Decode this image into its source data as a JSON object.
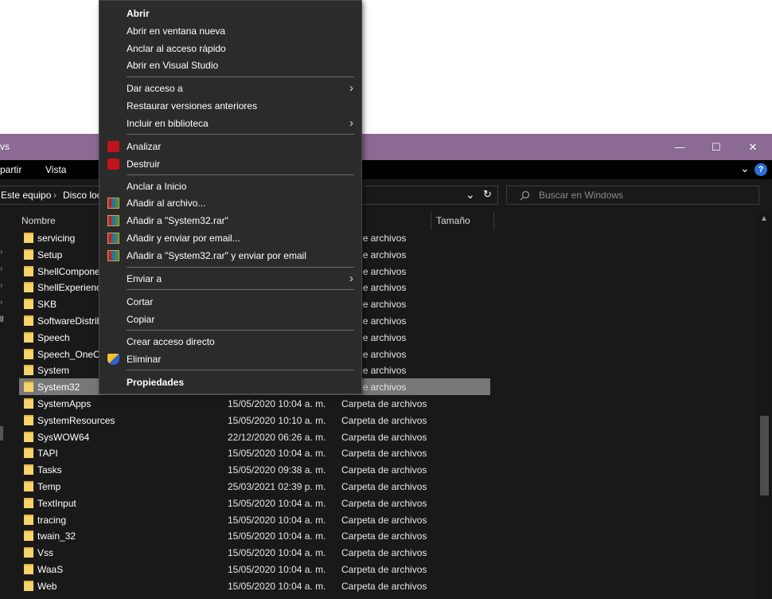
{
  "window": {
    "title_partial": "vs",
    "minimize": "—",
    "maximize": "☐",
    "close": "✕",
    "title_bg": "#8b6a94"
  },
  "ribbon": {
    "tab_share": "partir",
    "tab_view": "Vista",
    "expand": "⌄",
    "help": "?"
  },
  "address": {
    "crumb1": "Este equipo",
    "sep": "›",
    "crumb2": "Disco loc",
    "dropdown": "⌄",
    "refresh": "↻"
  },
  "search": {
    "placeholder": "Buscar en Windows",
    "icon": "search-icon"
  },
  "columns": {
    "name": "Nombre",
    "size": "Tamaño"
  },
  "rows": [
    {
      "name": "servicing",
      "date": "",
      "type": "eta de archivos",
      "selected": false
    },
    {
      "name": "Setup",
      "date": "",
      "type": "eta de archivos",
      "selected": false
    },
    {
      "name": "ShellCompone",
      "date": "",
      "type": "eta de archivos",
      "selected": false
    },
    {
      "name": "ShellExperienc",
      "date": "",
      "type": "eta de archivos",
      "selected": false
    },
    {
      "name": "SKB",
      "date": "",
      "type": "eta de archivos",
      "selected": false
    },
    {
      "name": "SoftwareDistrib",
      "date": "",
      "type": "eta de archivos",
      "selected": false
    },
    {
      "name": "Speech",
      "date": "",
      "type": "eta de archivos",
      "selected": false
    },
    {
      "name": "Speech_OneCo",
      "date": "",
      "type": "eta de archivos",
      "selected": false
    },
    {
      "name": "System",
      "date": "",
      "type": "eta de archivos",
      "selected": false
    },
    {
      "name": "System32",
      "date": "",
      "type": "eta de archivos",
      "selected": true
    },
    {
      "name": "SystemApps",
      "date": "15/05/2020 10:04 a. m.",
      "type": "Carpeta de archivos",
      "selected": false
    },
    {
      "name": "SystemResources",
      "date": "15/05/2020 10:10 a. m.",
      "type": "Carpeta de archivos",
      "selected": false
    },
    {
      "name": "SysWOW64",
      "date": "22/12/2020 06:26 a. m.",
      "type": "Carpeta de archivos",
      "selected": false
    },
    {
      "name": "TAPI",
      "date": "15/05/2020 10:04 a. m.",
      "type": "Carpeta de archivos",
      "selected": false
    },
    {
      "name": "Tasks",
      "date": "15/05/2020 09:38 a. m.",
      "type": "Carpeta de archivos",
      "selected": false
    },
    {
      "name": "Temp",
      "date": "25/03/2021 02:39 p. m.",
      "type": "Carpeta de archivos",
      "selected": false
    },
    {
      "name": "TextInput",
      "date": "15/05/2020 10:04 a. m.",
      "type": "Carpeta de archivos",
      "selected": false
    },
    {
      "name": "tracing",
      "date": "15/05/2020 10:04 a. m.",
      "type": "Carpeta de archivos",
      "selected": false
    },
    {
      "name": "twain_32",
      "date": "15/05/2020 10:04 a. m.",
      "type": "Carpeta de archivos",
      "selected": false
    },
    {
      "name": "Vss",
      "date": "15/05/2020 10:04 a. m.",
      "type": "Carpeta de archivos",
      "selected": false
    },
    {
      "name": "WaaS",
      "date": "15/05/2020 10:04 a. m.",
      "type": "Carpeta de archivos",
      "selected": false
    },
    {
      "name": "Web",
      "date": "15/05/2020 10:04 a. m.",
      "type": "Carpeta de archivos",
      "selected": false
    }
  ],
  "context_menu": {
    "open": "Abrir",
    "open_new_window": "Abrir en ventana nueva",
    "pin_quick_access": "Anclar al acceso rápido",
    "open_visual_studio": "Abrir en Visual Studio",
    "give_access": "Dar acceso a",
    "restore_versions": "Restaurar versiones anteriores",
    "include_library": "Incluir en biblioteca",
    "scan": "Analizar",
    "shred": "Destruir",
    "pin_start": "Anclar a Inicio",
    "add_archive": "Añadir al archivo...",
    "add_rar": "Añadir a \"System32.rar\"",
    "add_email": "Añadir y enviar por email...",
    "add_rar_email": "Añadir a \"System32.rar\" y enviar por email",
    "send_to": "Enviar a",
    "cut": "Cortar",
    "copy": "Copiar",
    "create_shortcut": "Crear acceso directo",
    "delete": "Eliminar",
    "properties": "Propiedades",
    "submenu_arrow": "›"
  }
}
